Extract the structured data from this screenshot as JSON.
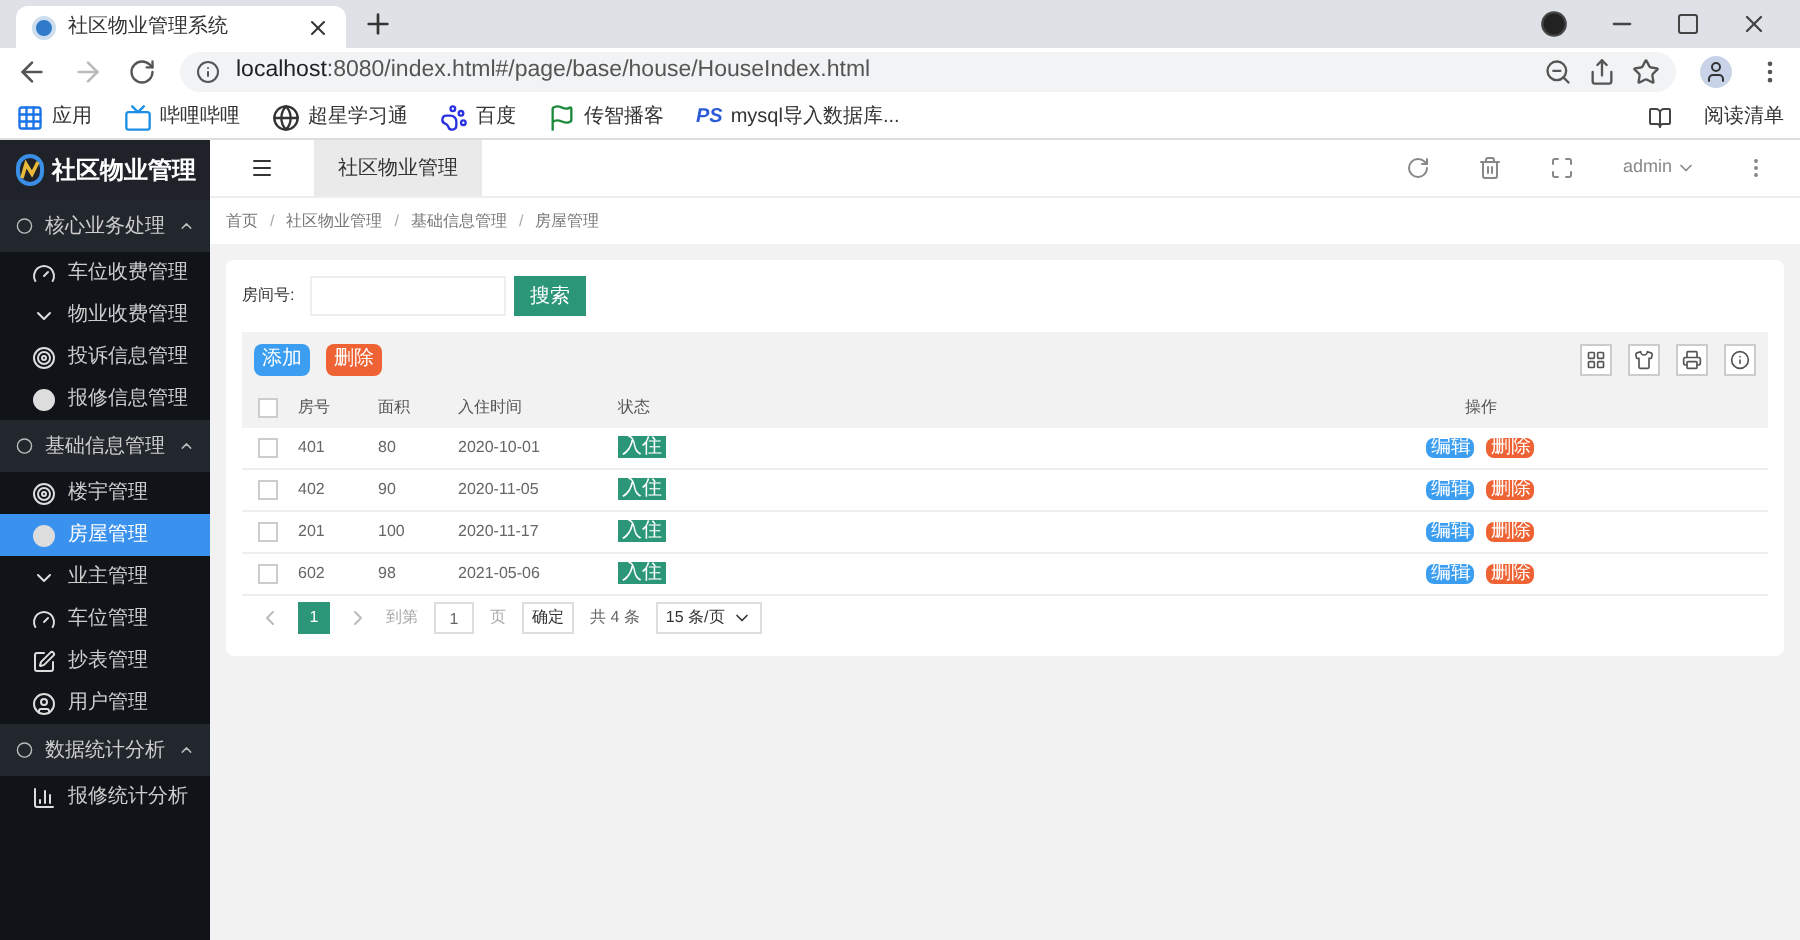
{
  "browser": {
    "tab_title": "社区物业管理系统",
    "url_host": "localhost",
    "url_rest": ":8080/index.html#/page/base/house/HouseIndex.html",
    "bookmarks": [
      {
        "label": "应用",
        "kind": "apps"
      },
      {
        "label": "哔哩哔哩",
        "kind": "tv"
      },
      {
        "label": "超星学习通",
        "kind": "globe"
      },
      {
        "label": "百度",
        "kind": "paw"
      },
      {
        "label": "传智播客",
        "kind": "flag"
      },
      {
        "label": "mysql导入数据库...",
        "kind": "ps",
        "icon_text": "PS"
      }
    ],
    "reading_list": "阅读清单"
  },
  "sidebar": {
    "logo": "社区物业管理",
    "groups": [
      {
        "label": "核心业务处理",
        "expanded": true,
        "children": [
          {
            "label": "车位收费管理",
            "kind": "gauge",
            "selected": false
          },
          {
            "label": "物业收费管理",
            "kind": "chevron",
            "selected": false
          },
          {
            "label": "投诉信息管理",
            "kind": "target",
            "selected": false
          },
          {
            "label": "报修信息管理",
            "kind": "dot",
            "selected": false
          }
        ]
      },
      {
        "label": "基础信息管理",
        "expanded": true,
        "children": [
          {
            "label": "楼宇管理",
            "kind": "target",
            "selected": false
          },
          {
            "label": "房屋管理",
            "kind": "dot",
            "selected": true
          },
          {
            "label": "业主管理",
            "kind": "chevron",
            "selected": false
          },
          {
            "label": "车位管理",
            "kind": "gauge",
            "selected": false
          },
          {
            "label": "抄表管理",
            "kind": "edit",
            "selected": false
          },
          {
            "label": "用户管理",
            "kind": "user",
            "selected": false
          }
        ]
      },
      {
        "label": "数据统计分析",
        "expanded": true,
        "children": [
          {
            "label": "报修统计分析",
            "kind": "chart",
            "selected": false
          }
        ]
      }
    ]
  },
  "header": {
    "tab": "社区物业管理",
    "user": "admin"
  },
  "breadcrumb": [
    "首页",
    "社区物业管理",
    "基础信息管理",
    "房屋管理"
  ],
  "breadcrumb_separators": [
    "/",
    "/",
    "/"
  ],
  "search": {
    "label": "房间号:",
    "button": "搜索"
  },
  "toolbar": {
    "add": "添加",
    "delete": "删除"
  },
  "table": {
    "select_all_checked": false,
    "columns": [
      "房号",
      "面积",
      "入住时间",
      "状态",
      "操作"
    ],
    "rows": [
      {
        "room": "401",
        "area": "80",
        "date": "2020-10-01",
        "status": "入住",
        "checked": false,
        "actions": [
          "编辑",
          "删除"
        ]
      },
      {
        "room": "402",
        "area": "90",
        "date": "2020-11-05",
        "status": "入住",
        "checked": false,
        "actions": [
          "编辑",
          "删除"
        ]
      },
      {
        "room": "201",
        "area": "100",
        "date": "2020-11-17",
        "status": "入住",
        "checked": false,
        "actions": [
          "编辑",
          "删除"
        ]
      },
      {
        "room": "602",
        "area": "98",
        "date": "2021-05-06",
        "status": "入住",
        "checked": false,
        "actions": [
          "编辑",
          "删除"
        ]
      }
    ]
  },
  "pagination": {
    "pages": [
      {
        "label": "1",
        "selected": true
      }
    ],
    "goto": "到第",
    "page_value": "1",
    "page_unit": "页",
    "confirm": "确定",
    "total": "共 4 条",
    "page_size": "15 条/页"
  }
}
